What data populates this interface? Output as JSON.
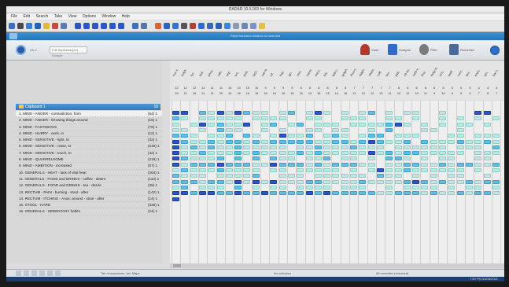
{
  "app": {
    "title": "RADAR 10.5.003 for Windows",
    "menu": [
      "File",
      "Edit",
      "Search",
      "Take",
      "View",
      "Options",
      "Window",
      "Help"
    ]
  },
  "header": {
    "center_text": "Repertorization window for selected"
  },
  "subtoolbar": {
    "search_label": "Lib 2",
    "dropdown_value": "Full Synthesis (en) Sample",
    "buttons": [
      "Case",
      "Analysis",
      "Filter",
      "Remedies"
    ]
  },
  "clipboard": {
    "title": "Clipboard 1",
    "count": "16"
  },
  "rubrics": [
    {
      "label": "1. MIND - ANGER - contradiction, from",
      "count": "(64) 1"
    },
    {
      "label": "2. MIND - ANGER - throwing things around",
      "count": "(18) 1"
    },
    {
      "label": "3. MIND - FASTIDIOUS",
      "count": "(76) 1"
    },
    {
      "label": "4. MIND - HURRY - work, in",
      "count": "(12) 1"
    },
    {
      "label": "5. MIND - SENSITIVE - light, to",
      "count": "(32) 1"
    },
    {
      "label": "6. MIND - SENSITIVE - noise, to",
      "count": "(246) 1"
    },
    {
      "label": "7. MIND - SENSITIVE - touch, to",
      "count": "(42) 1"
    },
    {
      "label": "8. MIND - QUARRELSOME",
      "count": "(218) 1"
    },
    {
      "label": "9. MIND - AMBITION - increased",
      "count": "(57) 1"
    },
    {
      "label": "10. GENERALS - HEAT - lack of vital heat",
      "count": "(264) 1"
    },
    {
      "label": "11. GENERALS - FOOD and DRINKS - coffee - desire",
      "count": "(110) 1"
    },
    {
      "label": "12. GENERALS - FOOD and DRINKS - tea - desire",
      "count": "(39) 1"
    },
    {
      "label": "13. RECTUM - PAIN - burning - stool - after",
      "count": "(142) 1"
    },
    {
      "label": "14. RECTUM - ITCHING - Anus; around - stool - after",
      "count": "(14) 1"
    },
    {
      "label": "15. STOOL - HARD",
      "count": "(336) 1"
    },
    {
      "label": "16. GENERALS - SEDENTARY habits",
      "count": "(24) 1"
    }
  ],
  "remedies": {
    "names": [
      "nux-v.",
      "sulph.",
      "lyc.",
      "bell.",
      "phos.",
      "calc.",
      "sep.",
      "ars.",
      "puls.",
      "lach.",
      "nat-m.",
      "sil.",
      "hep.",
      "ign.",
      "chin.",
      "caust.",
      "merc.",
      "bry.",
      "kali-c.",
      "graph.",
      "rhus-t.",
      "staph.",
      "cham.",
      "coff.",
      "aur.",
      "plat.",
      "nit-ac.",
      "carb-v.",
      "thuj.",
      "mag-m.",
      "zinc.",
      "asaf.",
      "cocc.",
      "ferr.",
      "anac.",
      "arn.",
      "bar-c."
    ],
    "score_row": [
      "12",
      "12",
      "12",
      "12",
      "11",
      "11",
      "10",
      "10",
      "10",
      "10",
      "9",
      "9",
      "9",
      "9",
      "8",
      "8",
      "8",
      "8",
      "8",
      "8",
      "7",
      "7",
      "7",
      "7",
      "7",
      "6",
      "6",
      "6",
      "6",
      "6",
      "5",
      "5",
      "5",
      "5",
      "4",
      "4",
      "4"
    ],
    "count_row": [
      "29",
      "21",
      "16",
      "21",
      "21",
      "20",
      "19",
      "16",
      "16",
      "15",
      "16",
      "16",
      "16",
      "15",
      "15",
      "13",
      "16",
      "15",
      "14",
      "16",
      "11",
      "13",
      "12",
      "13",
      "11",
      "10",
      "12",
      "10",
      "11",
      "9",
      "10",
      "9",
      "9",
      "9",
      "7",
      "8",
      "7"
    ]
  },
  "grid": [
    [
      3,
      3,
      0,
      2,
      1,
      3,
      1,
      3,
      2,
      1,
      1,
      0,
      1,
      2,
      0,
      1,
      3,
      1,
      0,
      1,
      0,
      1,
      2,
      0,
      1,
      0,
      1,
      1,
      0,
      0,
      1,
      0,
      0,
      0,
      3,
      3,
      0
    ],
    [
      2,
      1,
      0,
      1,
      1,
      1,
      1,
      1,
      0,
      1,
      1,
      1,
      1,
      0,
      0,
      1,
      1,
      0,
      0,
      1,
      1,
      1,
      0,
      0,
      1,
      1,
      0,
      1,
      0,
      0,
      1,
      0,
      1,
      0,
      1,
      0,
      1
    ],
    [
      1,
      0,
      1,
      3,
      1,
      2,
      1,
      1,
      3,
      0,
      1,
      2,
      0,
      1,
      2,
      0,
      1,
      1,
      1,
      0,
      1,
      1,
      1,
      1,
      2,
      3,
      1,
      0,
      1,
      0,
      1,
      0,
      1,
      1,
      0,
      1,
      0
    ],
    [
      1,
      1,
      0,
      1,
      0,
      2,
      1,
      1,
      0,
      0,
      1,
      0,
      1,
      0,
      0,
      1,
      1,
      0,
      1,
      1,
      0,
      0,
      1,
      0,
      2,
      0,
      0,
      0,
      1,
      1,
      0,
      0,
      1,
      0,
      0,
      0,
      0
    ],
    [
      2,
      2,
      1,
      0,
      1,
      1,
      2,
      0,
      2,
      1,
      0,
      1,
      3,
      1,
      1,
      2,
      0,
      1,
      2,
      1,
      0,
      1,
      2,
      2,
      0,
      1,
      1,
      1,
      0,
      0,
      0,
      1,
      1,
      0,
      1,
      1,
      1
    ],
    [
      3,
      2,
      1,
      1,
      2,
      1,
      2,
      2,
      1,
      2,
      1,
      2,
      2,
      2,
      2,
      2,
      1,
      1,
      2,
      2,
      1,
      2,
      3,
      2,
      1,
      1,
      2,
      0,
      2,
      1,
      1,
      1,
      2,
      1,
      1,
      2,
      1
    ],
    [
      3,
      1,
      2,
      1,
      2,
      1,
      1,
      2,
      1,
      1,
      1,
      1,
      1,
      0,
      1,
      1,
      2,
      1,
      1,
      1,
      2,
      1,
      1,
      1,
      0,
      1,
      1,
      1,
      1,
      1,
      1,
      0,
      1,
      1,
      1,
      0,
      2
    ],
    [
      3,
      1,
      1,
      2,
      1,
      1,
      1,
      2,
      1,
      2,
      1,
      1,
      1,
      1,
      2,
      1,
      2,
      1,
      1,
      1,
      1,
      1,
      3,
      1,
      2,
      1,
      2,
      2,
      1,
      1,
      1,
      1,
      1,
      0,
      1,
      1,
      1
    ],
    [
      3,
      2,
      1,
      1,
      1,
      2,
      0,
      2,
      0,
      2,
      0,
      2,
      1,
      1,
      0,
      1,
      1,
      2,
      0,
      1,
      1,
      0,
      1,
      0,
      2,
      2,
      1,
      0,
      1,
      0,
      1,
      1,
      0,
      0,
      1,
      1,
      0
    ],
    [
      3,
      1,
      2,
      2,
      2,
      3,
      2,
      2,
      2,
      1,
      1,
      3,
      2,
      2,
      2,
      1,
      2,
      1,
      2,
      2,
      2,
      1,
      1,
      0,
      1,
      1,
      2,
      2,
      1,
      1,
      2,
      1,
      2,
      2,
      1,
      1,
      2
    ],
    [
      1,
      2,
      1,
      1,
      1,
      2,
      1,
      1,
      1,
      1,
      0,
      1,
      1,
      0,
      1,
      1,
      1,
      1,
      1,
      0,
      1,
      0,
      1,
      3,
      1,
      1,
      2,
      1,
      1,
      1,
      1,
      1,
      1,
      0,
      1,
      0,
      1
    ],
    [
      2,
      1,
      1,
      1,
      0,
      1,
      1,
      1,
      1,
      2,
      0,
      0,
      1,
      1,
      1,
      0,
      1,
      1,
      1,
      1,
      1,
      1,
      0,
      2,
      1,
      1,
      0,
      1,
      0,
      1,
      0,
      1,
      1,
      0,
      0,
      1,
      0
    ],
    [
      2,
      2,
      2,
      1,
      2,
      2,
      1,
      3,
      1,
      3,
      1,
      3,
      1,
      1,
      1,
      2,
      2,
      1,
      1,
      1,
      1,
      2,
      1,
      1,
      1,
      1,
      2,
      3,
      2,
      1,
      2,
      1,
      1,
      2,
      1,
      2,
      2
    ],
    [
      1,
      2,
      0,
      1,
      1,
      1,
      0,
      2,
      0,
      1,
      0,
      1,
      1,
      0,
      1,
      1,
      1,
      1,
      0,
      1,
      1,
      1,
      0,
      0,
      1,
      0,
      1,
      1,
      1,
      1,
      0,
      1,
      0,
      1,
      1,
      0,
      1
    ],
    [
      3,
      3,
      2,
      3,
      3,
      2,
      2,
      3,
      2,
      2,
      3,
      2,
      2,
      2,
      2,
      3,
      2,
      3,
      2,
      2,
      2,
      2,
      2,
      1,
      1,
      2,
      2,
      2,
      1,
      2,
      1,
      1,
      2,
      1,
      2,
      2,
      1
    ],
    [
      3,
      0,
      0,
      0,
      0,
      0,
      0,
      0,
      0,
      0,
      0,
      0,
      0,
      0,
      0,
      0,
      0,
      0,
      0,
      0,
      0,
      0,
      0,
      0,
      0,
      0,
      0,
      0,
      0,
      0,
      0,
      0,
      0,
      0,
      0,
      0,
      0
    ]
  ],
  "status": {
    "left_text": "Tab of symptoms, sel. Major",
    "mid_text": "No selection",
    "right_text": "All remedies (unsorted)",
    "time": "7:50 PM",
    "date": "03/08/2021"
  }
}
